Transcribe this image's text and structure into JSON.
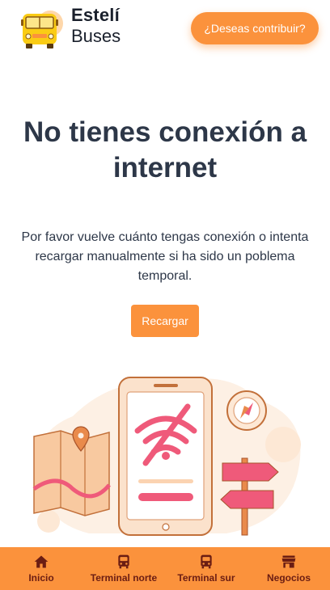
{
  "header": {
    "brand_line1": "Estelí",
    "brand_line2": "Buses",
    "logo_icon": "bus-icon",
    "contribute_label": "¿Deseas contribuir?"
  },
  "main": {
    "title": "No tienes conexión a internet",
    "message": "Por favor vuelve cuánto tengas conexión o intenta recargar manualmente si ha sido un poblema temporal.",
    "reload_label": "Recargar",
    "illustration_icon": "no-wifi-phone-illustration"
  },
  "bottom_nav": {
    "items": [
      {
        "label": "Inicio",
        "icon": "home-icon"
      },
      {
        "label": "Terminal norte",
        "icon": "bus-icon"
      },
      {
        "label": "Terminal sur",
        "icon": "bus-icon"
      },
      {
        "label": "Negocios",
        "icon": "store-icon"
      }
    ]
  },
  "colors": {
    "accent": "#fb923c",
    "nav_text": "#6b1d13",
    "heading": "#2d3748",
    "illustration_pink": "#ef5a7a"
  }
}
